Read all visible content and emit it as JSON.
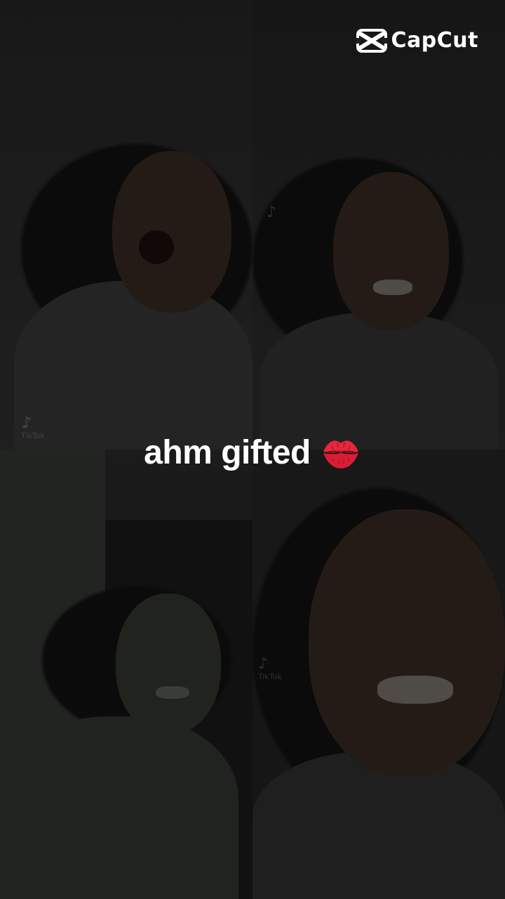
{
  "watermark": {
    "brand": "CapCut"
  },
  "caption": {
    "text": "ahm gifted",
    "emoji": "💋"
  },
  "clips": [
    {
      "position": "top-left",
      "tiktok_label": "TikTok"
    },
    {
      "position": "top-right",
      "tiktok_label": ""
    },
    {
      "position": "bottom-left",
      "tiktok_label": ""
    },
    {
      "position": "bottom-right",
      "tiktok_label": "TikTok"
    }
  ],
  "icons": {
    "capcut_logo": "capcut-logo-icon",
    "tiktok_logo": "tiktok-note-icon",
    "kiss_emoji": "kiss-mark-icon"
  },
  "colors": {
    "caption_text": "#ffffff",
    "logo": "#ffffff",
    "kiss": "#e8263c"
  }
}
